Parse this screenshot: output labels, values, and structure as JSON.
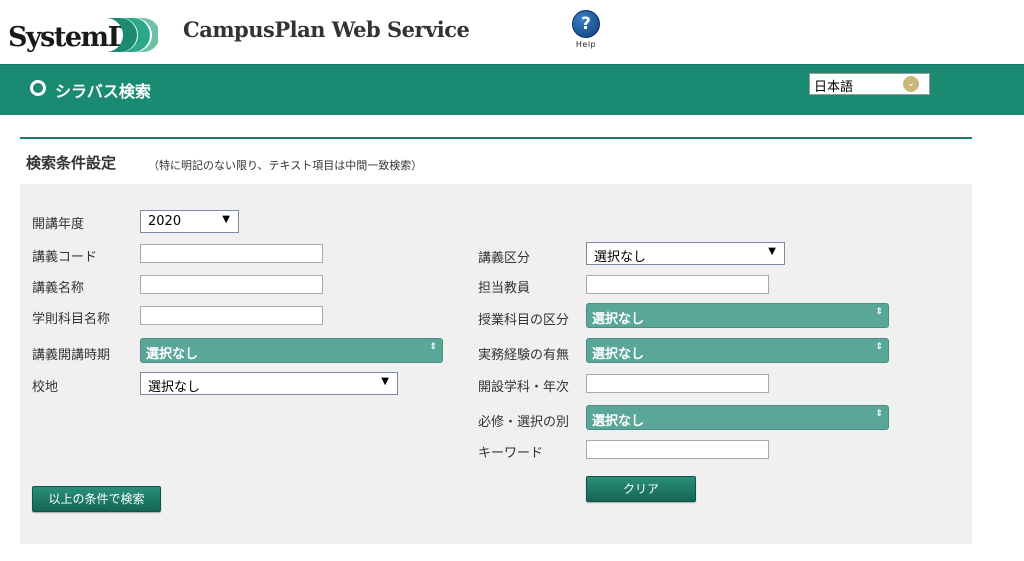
{
  "header": {
    "logo_text": "SystemD",
    "brand_title": "CampusPlan Web Service",
    "help_label": "Help"
  },
  "band": {
    "title": "シラバス検索",
    "language": "日本語"
  },
  "panel": {
    "heading": "検索条件設定",
    "note": "（特に明記のない限り、テキスト項目は中間一致検索）"
  },
  "form": {
    "year_label": "開講年度",
    "year_value": "2020",
    "course_code_label": "講義コード",
    "course_name_label": "講義名称",
    "academic_subject_label": "学則科目名称",
    "period_label": "講義開講時期",
    "period_value": "選択なし",
    "campus_label": "校地",
    "campus_value": "選択なし",
    "category_label": "講義区分",
    "category_value": "選択なし",
    "teacher_label": "担当教員",
    "subject_class_label": "授業科目の区分",
    "subject_class_value": "選択なし",
    "experience_label": "実務経験の有無",
    "experience_value": "選択なし",
    "department_label": "開設学科・年次",
    "required_label": "必修・選択の別",
    "required_value": "選択なし",
    "keyword_label": "キーワード",
    "search_button": "以上の条件で検索",
    "clear_button": "クリア"
  },
  "colors": {
    "band": "#1a8a73",
    "panel_bg": "#f0f0f0",
    "select_green": "#5aa79a"
  }
}
